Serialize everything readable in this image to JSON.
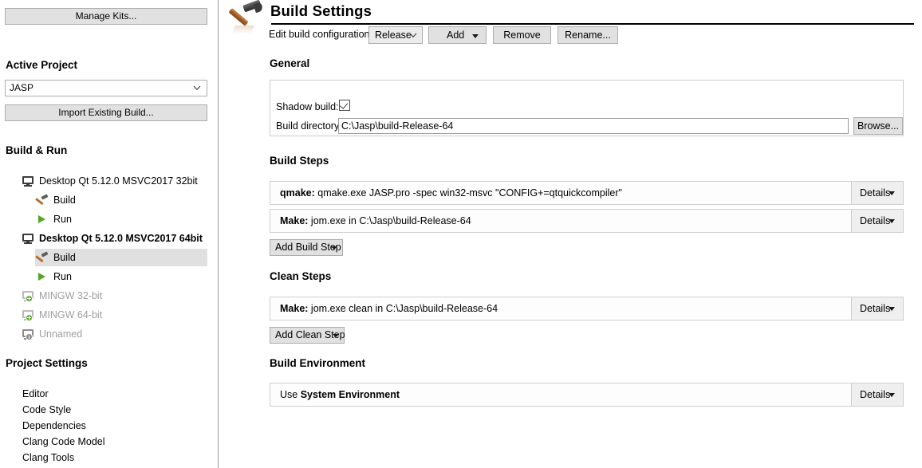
{
  "sidebar": {
    "manage_kits_label": "Manage Kits...",
    "active_project_heading": "Active Project",
    "project_combo_value": "JASP",
    "import_existing_build_label": "Import Existing Build...",
    "build_run_heading": "Build & Run",
    "tree": [
      {
        "label": "Desktop Qt 5.12.0 MSVC2017 32bit",
        "icon": "monitor-icon",
        "level": 0,
        "bold": false,
        "disabled": false,
        "selected": false
      },
      {
        "label": "Build",
        "icon": "hammer-icon",
        "level": 1,
        "bold": false,
        "disabled": false,
        "selected": false
      },
      {
        "label": "Run",
        "icon": "play-icon",
        "level": 1,
        "bold": false,
        "disabled": false,
        "selected": false
      },
      {
        "label": "Desktop Qt 5.12.0 MSVC2017 64bit",
        "icon": "monitor-icon",
        "level": 0,
        "bold": true,
        "disabled": false,
        "selected": false
      },
      {
        "label": "Build",
        "icon": "hammer-icon",
        "level": 1,
        "bold": false,
        "disabled": false,
        "selected": true
      },
      {
        "label": "Run",
        "icon": "play-icon",
        "level": 1,
        "bold": false,
        "disabled": false,
        "selected": false
      },
      {
        "label": "MINGW 32-bit",
        "icon": "monitor-add-icon",
        "level": 0,
        "bold": false,
        "disabled": true,
        "selected": false
      },
      {
        "label": "MINGW 64-bit",
        "icon": "monitor-add-icon",
        "level": 0,
        "bold": false,
        "disabled": true,
        "selected": false
      },
      {
        "label": "Unnamed",
        "icon": "monitor-warning-icon",
        "level": 0,
        "bold": false,
        "disabled": true,
        "selected": false
      }
    ],
    "project_settings_heading": "Project Settings",
    "project_settings": [
      {
        "label": "Editor"
      },
      {
        "label": "Code Style"
      },
      {
        "label": "Dependencies"
      },
      {
        "label": "Clang Code Model"
      },
      {
        "label": "Clang Tools"
      }
    ]
  },
  "header": {
    "title": "Build Settings",
    "icon": "hammer-icon",
    "config_label": "Edit build configuration:",
    "config_value": "Release",
    "add_label": "Add",
    "remove_label": "Remove",
    "rename_label": "Rename..."
  },
  "general": {
    "heading": "General",
    "shadow_build_label": "Shadow build:",
    "shadow_build_checked": true,
    "build_directory_label": "Build directory:",
    "build_directory_value": "C:\\Jasp\\build-Release-64",
    "browse_label": "Browse..."
  },
  "build_steps": {
    "heading": "Build Steps",
    "steps": [
      {
        "name": "qmake:",
        "detail": " qmake.exe JASP.pro -spec win32-msvc \"CONFIG+=qtquickcompiler\"",
        "details_label": "Details"
      },
      {
        "name": "Make:",
        "detail": " jom.exe in C:\\Jasp\\build-Release-64",
        "details_label": "Details"
      }
    ],
    "add_label": "Add Build Step"
  },
  "clean_steps": {
    "heading": "Clean Steps",
    "steps": [
      {
        "name": "Make:",
        "detail": " jom.exe clean in C:\\Jasp\\build-Release-64",
        "details_label": "Details"
      }
    ],
    "add_label": "Add Clean Step"
  },
  "build_environment": {
    "heading": "Build Environment",
    "prefix": "Use ",
    "value": "System Environment",
    "details_label": "Details"
  },
  "colors": {
    "button_face": "#e1e1e1",
    "button_border": "#adadad",
    "selection": "#e0e0e0",
    "disabled_text": "#9f9f9f",
    "panel_border": "#cccccc",
    "run_green": "#53a626",
    "hammer_wood": "#a8602a"
  }
}
